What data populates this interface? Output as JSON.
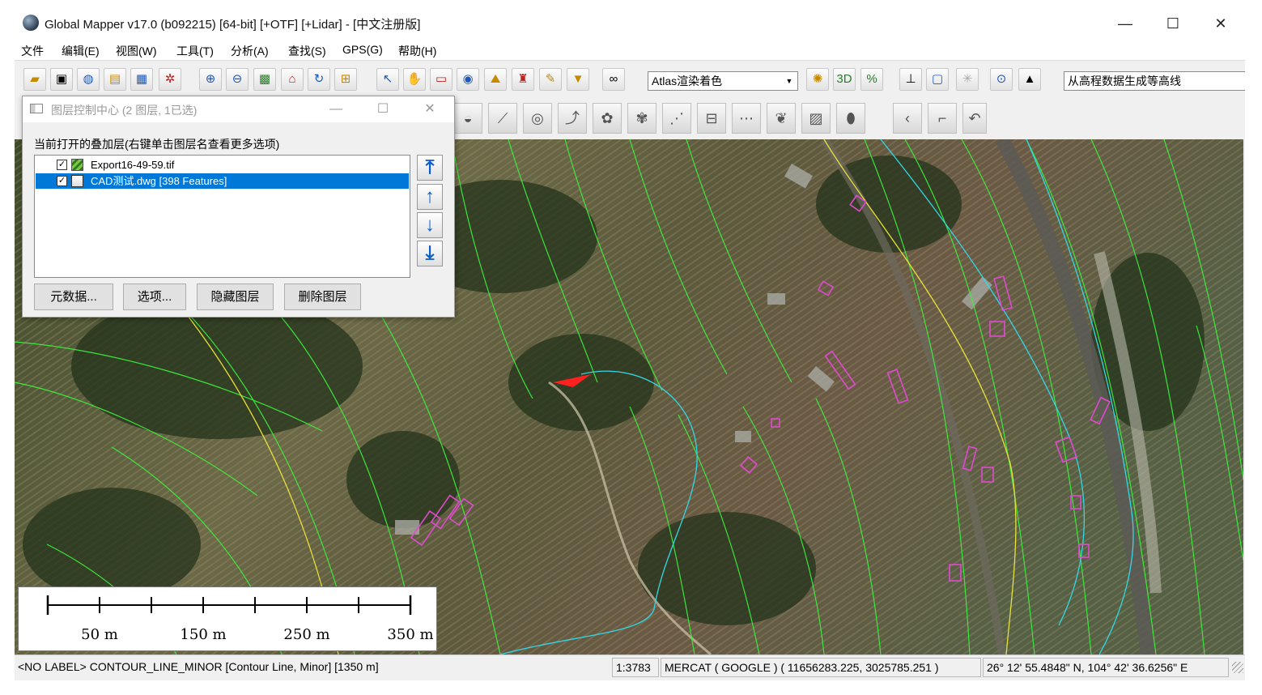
{
  "window": {
    "title": "Global Mapper v17.0 (b092215) [64-bit] [+OTF] [+Lidar] - [中文注册版]",
    "minimize_glyph": "—",
    "maximize_glyph": "☐",
    "close_glyph": "✕"
  },
  "menu": [
    "文件",
    "编辑(E)",
    "视图(W)",
    "工具(T)",
    "分析(A)",
    "查找(S)",
    "GPS(G)",
    "帮助(H)"
  ],
  "toolbar": {
    "render_mode": "Atlas渲染着色",
    "command": "从高程数据生成等高线",
    "icons": [
      "open-folder-icon",
      "save-icon",
      "globe-icon",
      "config-icon",
      "export-icon",
      "tools-icon",
      "zoom-in-icon",
      "zoom-out-icon",
      "full-view-icon",
      "home-icon",
      "refresh-icon",
      "grid-icon",
      "digitizer-icon",
      "pan-hand-icon",
      "measure-icon",
      "feature-info-icon",
      "path-profile-icon",
      "tower-icon",
      "pencil-icon",
      "filter-icon",
      "binoculars-icon",
      "shader-icon",
      "3d-view-icon",
      "percent-icon",
      "profile-icon",
      "page-icon",
      "star-icon",
      "gps-target-icon",
      "north-arrow-icon"
    ]
  },
  "dialog": {
    "title": "图层控制中心 (2 图层, 1已选)",
    "label": "当前打开的叠加层(右键单击图层名查看更多选项)",
    "layers": [
      {
        "name": "Export16-49-59.tif",
        "checked": true,
        "selected": false
      },
      {
        "name": "CAD测试.dwg [398 Features]",
        "checked": true,
        "selected": true
      }
    ],
    "buttons": {
      "metadata": "元数据...",
      "options": "选项...",
      "hide": "隐藏图层",
      "delete": "删除图层"
    }
  },
  "scalebar": {
    "labels": [
      "50 m",
      "150 m",
      "250 m",
      "350 m"
    ]
  },
  "status": {
    "feature": "<NO LABEL> CONTOUR_LINE_MINOR [Contour Line, Minor] [1350 m]",
    "scale": "1:3783",
    "projection": "MERCAT ( GOOGLE ) ( 11656283.225, 3025785.251 )",
    "latlon": "26° 12' 55.4848\" N, 104° 42' 36.6256\" E"
  }
}
